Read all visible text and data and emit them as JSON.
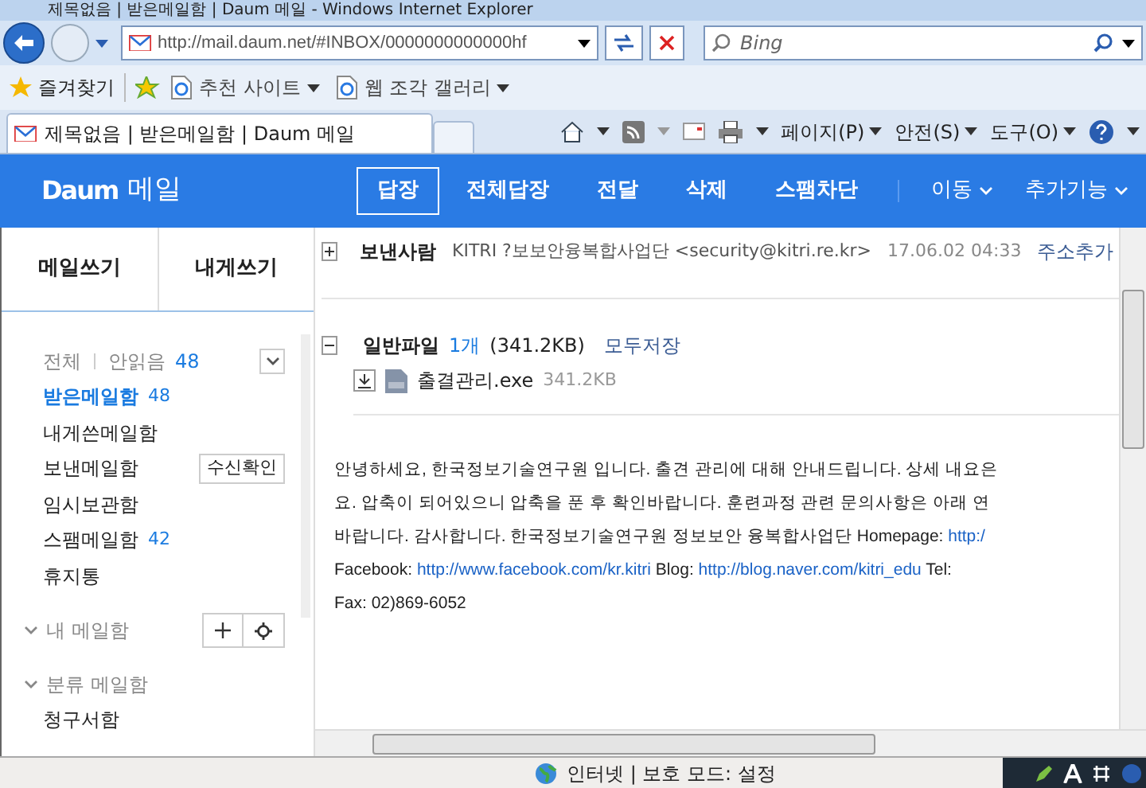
{
  "window": {
    "title": "제목없음 | 받은메일함 | Daum 메일 - Windows Internet Explorer"
  },
  "address_bar": {
    "url": "http://mail.daum.net/#INBOX/0000000000000hf",
    "search_placeholder": "Bing"
  },
  "favorites_bar": {
    "favorites": "즐겨찾기",
    "items": [
      "추천 사이트",
      "웹 조각 갤러리"
    ]
  },
  "tab": {
    "title": "제목없음 | 받은메일함 | Daum 메일"
  },
  "command_bar": [
    "페이지(P)",
    "안전(S)",
    "도구(O)"
  ],
  "header": {
    "logo": "Daum",
    "service": "메일",
    "actions": [
      {
        "label": "답장",
        "selected": true
      },
      {
        "label": "전체답장",
        "selected": false
      },
      {
        "label": "전달",
        "selected": false
      },
      {
        "label": "삭제",
        "selected": false
      },
      {
        "label": "스팸차단",
        "selected": false
      }
    ],
    "menus": [
      "이동",
      "추가기능"
    ]
  },
  "sidebar": {
    "compose": [
      "메일쓰기",
      "내게쓰기"
    ],
    "filter": {
      "all": "전체",
      "unread": "안읽음",
      "unread_count": "48"
    },
    "folders": [
      {
        "name": "받은메일함",
        "count": "48",
        "selected": true
      },
      {
        "name": "내게쓴메일함",
        "selected": false
      },
      {
        "name": "보낸메일함",
        "selected": false,
        "button": "수신확인"
      },
      {
        "name": "임시보관함",
        "selected": false
      },
      {
        "name": "스팸메일함",
        "count": "42",
        "selected": false
      },
      {
        "name": "휴지통",
        "selected": false
      }
    ],
    "my_mailbox": "내 메일함",
    "category_mailbox": "분류 메일함",
    "category_items": [
      "청구서함"
    ]
  },
  "message": {
    "sender_label": "보낸사람",
    "sender": "KITRI ?보보안융복합사업단 <security@kitri.re.kr>",
    "date": "17.06.02 04:33",
    "add_contact": "주소추가",
    "attachments": {
      "label": "일반파일",
      "count": "1개",
      "size": "(341.2KB)",
      "save_all": "모두저장",
      "files": [
        {
          "name": "출결관리.exe",
          "size": "341.2KB"
        }
      ]
    },
    "body": [
      [
        {
          "kind": "text",
          "text": "안녕하세요, 한국정보기술연구원 입니다. 출견 관리에 대해 안내드립니다. 상세 내요은"
        }
      ],
      [
        {
          "kind": "text",
          "text": "요. 압축이 되어있으니 압축을 푼 후 확인바랍니다. 훈련과정 관련 문의사항은 아래 연"
        }
      ],
      [
        {
          "kind": "text",
          "text": "바랍니다. 감사합니다. 한국정보기술연구원 정보보안 융복합사업단 Homepage: "
        },
        {
          "kind": "link",
          "text": "http:/"
        }
      ],
      [
        {
          "kind": "text",
          "text": "Facebook: "
        },
        {
          "kind": "link",
          "text": "http://www.facebook.com/kr.kitri"
        },
        {
          "kind": "text",
          "text": " Blog: "
        },
        {
          "kind": "link",
          "text": "http://blog.naver.com/kitri_edu"
        },
        {
          "kind": "text",
          "text": " Tel:"
        }
      ],
      [
        {
          "kind": "text",
          "text": "Fax: 02)869-6052"
        }
      ]
    ]
  },
  "status_bar": {
    "zone": "인터넷 | 보호 모드: 설정"
  }
}
